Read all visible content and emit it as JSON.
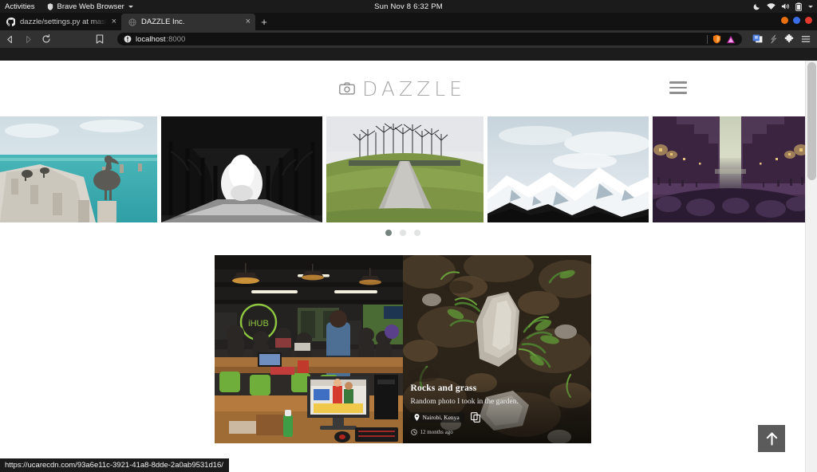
{
  "desktop": {
    "activities_label": "Activities",
    "app_name": "Brave Web Browser",
    "clock": "Sun Nov 8  6:32 PM",
    "tray_icons": [
      "moon-icon",
      "wifi-icon",
      "volume-icon",
      "battery-icon",
      "chevron-down-icon"
    ]
  },
  "browser": {
    "tabs": [
      {
        "title": "dazzle/settings.py at mast",
        "favicon": "github-icon",
        "active": false,
        "close_label": "×"
      },
      {
        "title": "DAZZLE Inc.",
        "favicon": "globe-icon",
        "active": true,
        "close_label": "×"
      }
    ],
    "new_tab_label": "+",
    "nav": {
      "back_label": "back-icon",
      "forward_label": "forward-icon",
      "reload_label": "reload-icon",
      "bookmark_label": "bookmark-icon"
    },
    "address": {
      "security_icon": "not-secure-icon",
      "host": "localhost",
      "port": ":8000",
      "full_url": "localhost:8000"
    },
    "toolbar_right_icons": [
      "brave-shields-icon",
      "triangle-extension-icon",
      "media-extension-icon",
      "wallet-extension-icon",
      "puzzle-extension-icon",
      "hamburger-menu-icon"
    ],
    "window_controls": [
      "minimize-dot",
      "maximize-dot",
      "close-dot"
    ],
    "window_control_colors": [
      "#e8700f",
      "#3a6ee8",
      "#e23a2e"
    ],
    "status_url": "https://ucarecdn.com/93a6e11c-3921-41a8-8dde-2a0ab9531d16/"
  },
  "site": {
    "logo_text": "DAZZLE",
    "logo_icon": "camera-icon",
    "menu_label": "hamburger-menu",
    "carousel": {
      "slides": [
        {
          "alt": "pelican-on-pier",
          "id": "slide-1"
        },
        {
          "alt": "black-and-white-tree-lined-road",
          "id": "slide-2"
        },
        {
          "alt": "grass-hill-with-path-and-trees",
          "id": "slide-3"
        },
        {
          "alt": "snowy-mountain-range",
          "id": "slide-4"
        },
        {
          "alt": "purple-toned-city-canal",
          "id": "slide-5"
        }
      ],
      "dots": [
        {
          "active": true
        },
        {
          "active": false
        },
        {
          "active": false
        }
      ],
      "active_index": 0
    },
    "cards": [
      {
        "id": "card-ihub",
        "alt": "coworking-space-with-people-at-desks",
        "title": "",
        "description": "",
        "location": "",
        "time": ""
      },
      {
        "id": "card-rocks",
        "alt": "rocks-and-grass-on-forest-floor",
        "title": "Rocks and grass",
        "description": "Random photo I took in the garden.",
        "location": "Nairobi, Kenya",
        "location_icon": "map-pin-icon",
        "copy_icon": "copy-icon",
        "time": "12 months ago",
        "time_icon": "clock-icon"
      }
    ],
    "scroll_top_label": "scroll-to-top"
  },
  "colors": {
    "dot_active": "#74857f",
    "dot_inactive": "#e1e4e3",
    "logo_gray": "#a8a8a8",
    "scroll_top_bg": "#5b5b5b"
  }
}
